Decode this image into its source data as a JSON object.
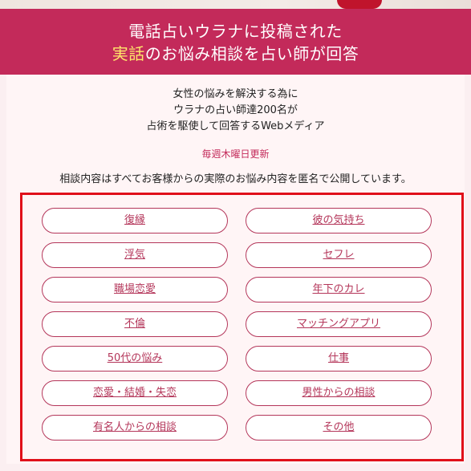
{
  "banner": {
    "line1": "電話占いウラナに投稿された",
    "line2_highlight": "実話",
    "line2_rest": "のお悩み相談を占い師が回答"
  },
  "intro": {
    "line1": "女性の悩みを解決する為に",
    "line2": "ウラナの占い師達200名が",
    "line3": "占術を駆使して回答するWebメディア"
  },
  "weekly_update": "毎週木曜日更新",
  "notice": "相談内容はすべてお客様からの実際のお悩み内容を匿名で公開しています。",
  "categories": [
    "復縁",
    "彼の気持ち",
    "浮気",
    "セフレ",
    "職場恋愛",
    "年下のカレ",
    "不倫",
    "マッチングアプリ",
    "50代の悩み",
    "仕事",
    "恋愛・結婚・失恋",
    "男性からの相談",
    "有名人からの相談",
    "その他"
  ],
  "colors": {
    "banner": "#c32a5a",
    "highlight": "#ffe76a",
    "button_border": "#b4365a",
    "frame": "#e0101a"
  }
}
